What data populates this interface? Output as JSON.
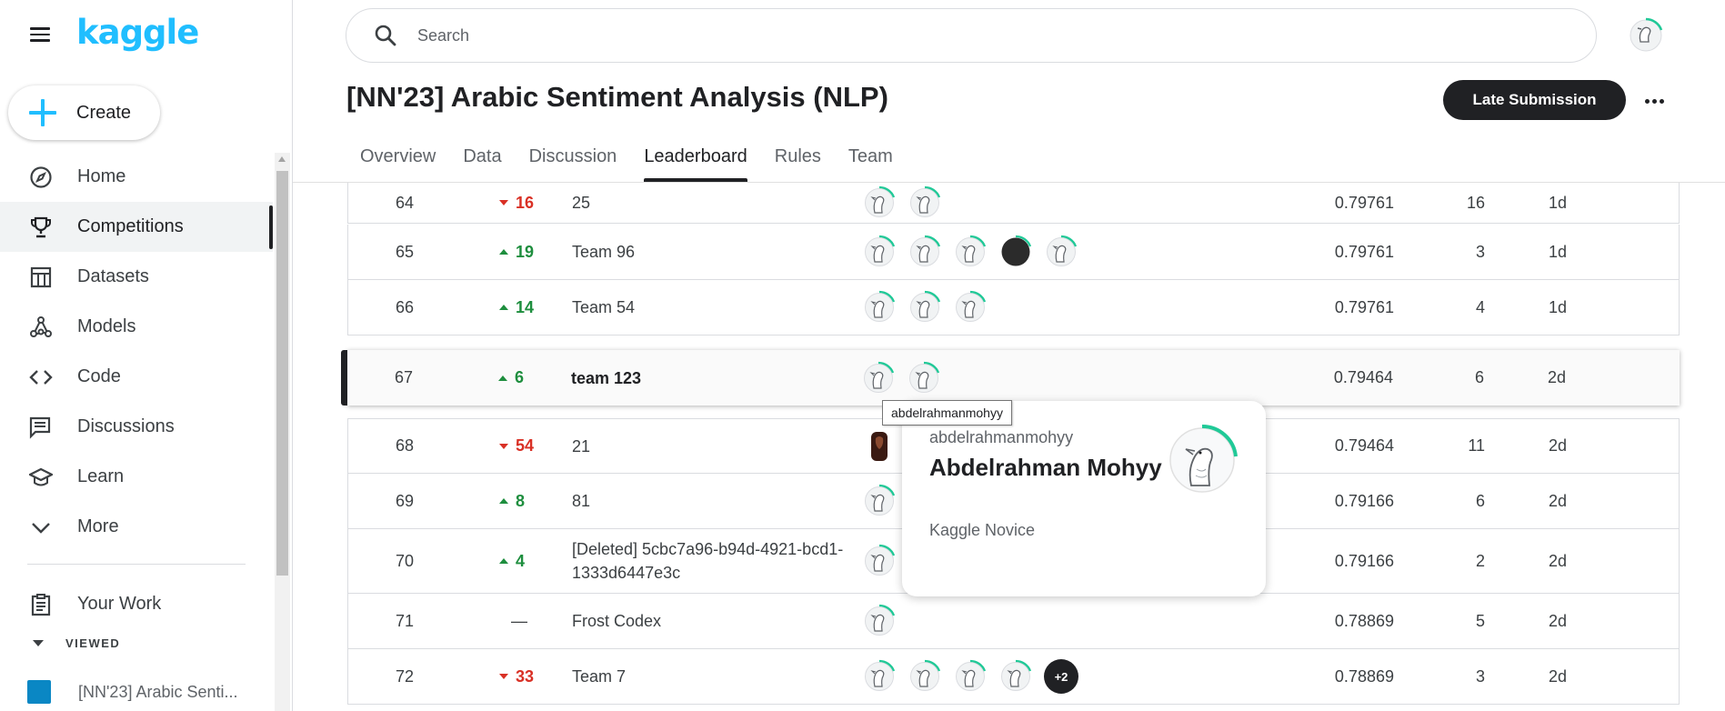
{
  "app": {
    "logo": "kaggle",
    "create_label": "Create"
  },
  "sidebar": {
    "items": [
      {
        "label": "Home",
        "icon": "compass-icon"
      },
      {
        "label": "Competitions",
        "icon": "trophy-icon",
        "active": true
      },
      {
        "label": "Datasets",
        "icon": "table-icon"
      },
      {
        "label": "Models",
        "icon": "models-icon"
      },
      {
        "label": "Code",
        "icon": "code-icon"
      },
      {
        "label": "Discussions",
        "icon": "discussion-icon"
      },
      {
        "label": "Learn",
        "icon": "graduation-cap-icon"
      },
      {
        "label": "More",
        "icon": "chevron-down-icon"
      }
    ],
    "your_work": "Your Work",
    "viewed_label": "VIEWED",
    "viewed_items": [
      {
        "label": "[NN'23] Arabic Senti..."
      }
    ]
  },
  "search": {
    "placeholder": "Search"
  },
  "competition": {
    "title": "[NN'23] Arabic Sentiment Analysis (NLP)",
    "late_submission": "Late Submission",
    "tabs": [
      "Overview",
      "Data",
      "Discussion",
      "Leaderboard",
      "Rules",
      "Team"
    ],
    "active_tab": "Leaderboard"
  },
  "leaderboard": {
    "rows": [
      {
        "rank": "64",
        "delta": "16",
        "direction": "down",
        "team": "25",
        "avatars": 2,
        "extra": "",
        "score": "0.79761",
        "entries": "16",
        "last": "1d"
      },
      {
        "rank": "65",
        "delta": "19",
        "direction": "up",
        "team": "Team 96",
        "avatars": 5,
        "extra": "",
        "score": "0.79761",
        "entries": "3",
        "last": "1d"
      },
      {
        "rank": "66",
        "delta": "14",
        "direction": "up",
        "team": "Team 54",
        "avatars": 3,
        "extra": "",
        "score": "0.79761",
        "entries": "4",
        "last": "1d"
      },
      {
        "rank": "67",
        "delta": "6",
        "direction": "up",
        "team": "team 123",
        "avatars": 2,
        "extra": "",
        "score": "0.79464",
        "entries": "6",
        "last": "2d",
        "highlight": true
      },
      {
        "rank": "68",
        "delta": "54",
        "direction": "down",
        "team": "21",
        "avatars": 1,
        "extra": "",
        "score": "0.79464",
        "entries": "11",
        "last": "2d"
      },
      {
        "rank": "69",
        "delta": "8",
        "direction": "up",
        "team": "81",
        "avatars": 1,
        "extra": "",
        "score": "0.79166",
        "entries": "6",
        "last": "2d"
      },
      {
        "rank": "70",
        "delta": "4",
        "direction": "up",
        "team": "[Deleted] 5cbc7a96-b94d-4921-bcd1-1333d6447e3c",
        "avatars": 1,
        "extra": "",
        "score": "0.79166",
        "entries": "2",
        "last": "2d"
      },
      {
        "rank": "71",
        "delta": "—",
        "direction": "flat",
        "team": "Frost Codex",
        "avatars": 1,
        "extra": "",
        "score": "0.78869",
        "entries": "5",
        "last": "2d"
      },
      {
        "rank": "72",
        "delta": "33",
        "direction": "down",
        "team": "Team 7",
        "avatars": 4,
        "extra": "+2",
        "score": "0.78869",
        "entries": "3",
        "last": "2d"
      }
    ]
  },
  "tooltip": {
    "text": "abdelrahmanmohyy"
  },
  "hovercard": {
    "username": "abdelrahmanmohyy",
    "display_name": "Abdelrahman Mohyy",
    "tier": "Kaggle Novice"
  },
  "colors": {
    "brand": "#20beff",
    "up": "#1e8e3e",
    "down": "#d93025",
    "progress_ring": "#20c997"
  }
}
